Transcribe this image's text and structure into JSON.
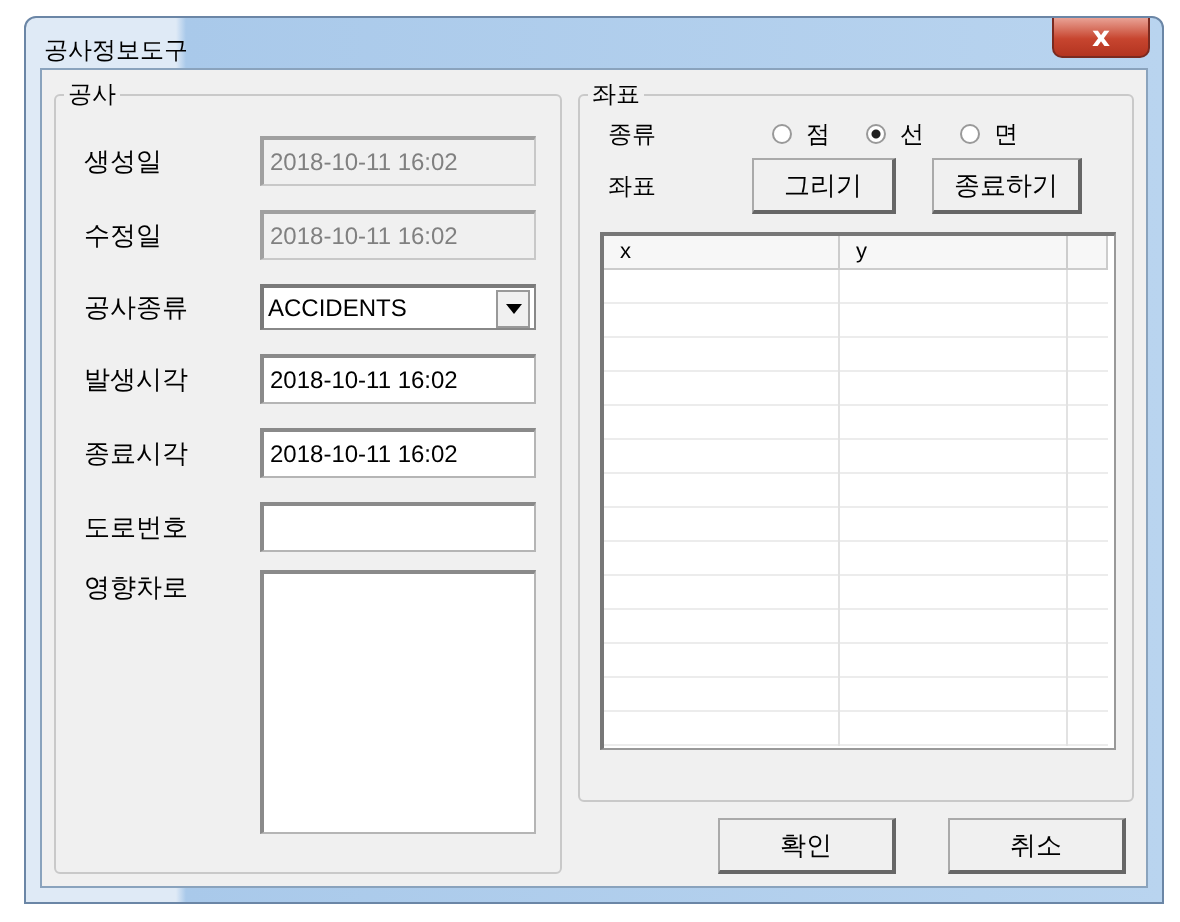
{
  "window": {
    "title": "공사정보도구",
    "close": "x"
  },
  "construction": {
    "title": "공사",
    "fields": [
      {
        "label": "생성일",
        "kind": "text",
        "value": "2018-10-11 16:02",
        "disabled": true
      },
      {
        "label": "수정일",
        "kind": "text",
        "value": "2018-10-11 16:02",
        "disabled": true
      },
      {
        "label": "공사종류",
        "kind": "dropdown",
        "value": "ACCIDENTS",
        "disabled": false
      },
      {
        "label": "발생시각",
        "kind": "text",
        "value": "2018-10-11 16:02",
        "disabled": false
      },
      {
        "label": "종료시각",
        "kind": "text",
        "value": "2018-10-11 16:02",
        "disabled": false
      },
      {
        "label": "도로번호",
        "kind": "text",
        "disabled": false
      },
      {
        "label": "영향차로",
        "kind": "textarea",
        "disabled": false
      }
    ]
  },
  "coordinates": {
    "title": "좌표",
    "type_label": "종류",
    "type_options": [
      {
        "label": "점",
        "selected": false
      },
      {
        "label": "선",
        "selected": true
      },
      {
        "label": "면",
        "selected": false
      }
    ],
    "coord_label": "좌표",
    "buttons": [
      "그리기",
      "종료하기"
    ],
    "table": {
      "columns": [
        "x",
        "y"
      ]
    }
  },
  "buttons": [
    "확인",
    "취소"
  ]
}
